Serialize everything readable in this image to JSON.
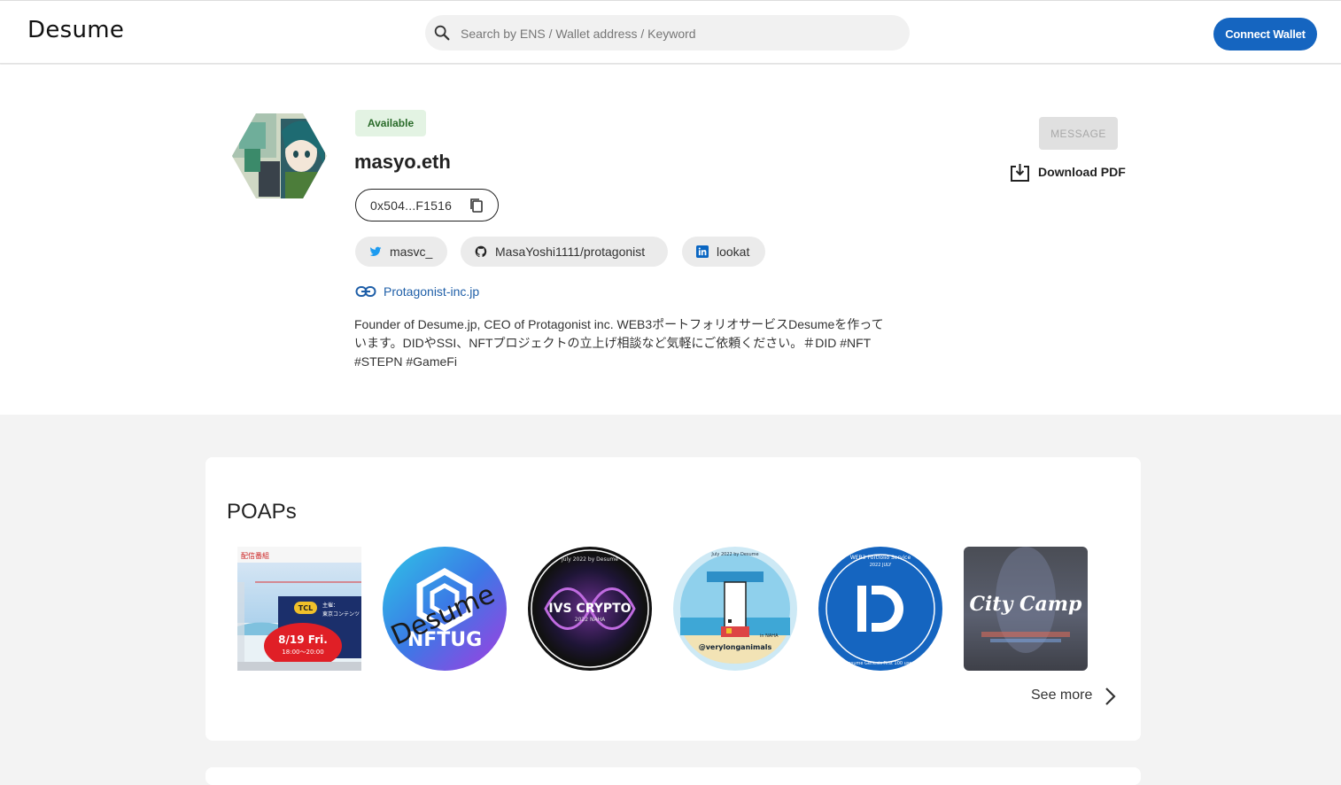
{
  "header": {
    "logo": "Desume",
    "search_placeholder": "Search by ENS / Wallet address / Keyword",
    "connect_label": "Connect Wallet"
  },
  "profile": {
    "status_badge": "Available",
    "name": "masyo.eth",
    "address": "0x504...F1516",
    "socials": {
      "twitter": "masvc_",
      "github": "MasaYoshi1111/protagonist",
      "linkedin": "lookat"
    },
    "website": "Protagonist-inc.jp",
    "bio": "Founder of Desume.jp, CEO of Protagonist inc. WEB3ポートフォリオサービスDesumeを作っています。DIDやSSI、NFTプロジェクトの立上げ相談など気軽にご依頼ください。＃DID #NFT #STEPN #GameFi",
    "message_label": "MESSAGE",
    "download_label": "Download PDF"
  },
  "poaps": {
    "title": "POAPs",
    "items": [
      {
        "name": "event-banner",
        "texts": [
          "8/19 Fri.",
          "18:00〜20:00",
          "TCL",
          "主催：",
          "東京コンテンツ",
          "配信番組"
        ]
      },
      {
        "name": "nftug",
        "texts": [
          "Desume",
          "NFTUG"
        ]
      },
      {
        "name": "ivs-crypto",
        "texts": [
          "IVS CRYPTO",
          "2022 NAHA",
          "July 2022 by Desume"
        ]
      },
      {
        "name": "verylonganimals",
        "texts": [
          "@verylonganimals",
          "in NAHA",
          "July 2022 by Desume"
        ]
      },
      {
        "name": "desume-first-100",
        "texts": [
          "WEB3 Portfolio Service",
          "2022 JULY",
          "Desume Genesis First 100 users"
        ]
      },
      {
        "name": "city-camp",
        "texts": [
          "City Camp"
        ]
      }
    ],
    "see_more": "See more"
  }
}
